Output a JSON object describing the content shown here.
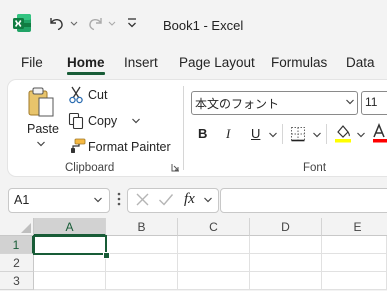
{
  "titlebar": {
    "doc_title": "Book1  -  Excel",
    "app_icon": "excel-logo",
    "undo_icon": "undo-icon",
    "redo_icon": "redo-icon",
    "customize_icon": "customize-qat-icon"
  },
  "tabs": [
    "File",
    "Home",
    "Insert",
    "Page Layout",
    "Formulas",
    "Data"
  ],
  "active_tab": "Home",
  "ribbon": {
    "clipboard": {
      "paste_label": "Paste",
      "cut_label": "Cut",
      "copy_label": "Copy",
      "format_painter_label": "Format Painter",
      "group_label": "Clipboard"
    },
    "font": {
      "font_name": "本文のフォント",
      "font_size": "11",
      "bold_label": "B",
      "italic_label": "I",
      "underline_label": "U",
      "group_label": "Font"
    }
  },
  "formula_bar": {
    "name_box_value": "A1",
    "fx_label": "fx",
    "formula_value": ""
  },
  "grid": {
    "columns": [
      "A",
      "B",
      "C",
      "D",
      "E"
    ],
    "rows": [
      "1",
      "2",
      "3"
    ],
    "selected_cell": "A1"
  },
  "colors": {
    "accent": "#185c37",
    "excel_green": "#107c41"
  }
}
